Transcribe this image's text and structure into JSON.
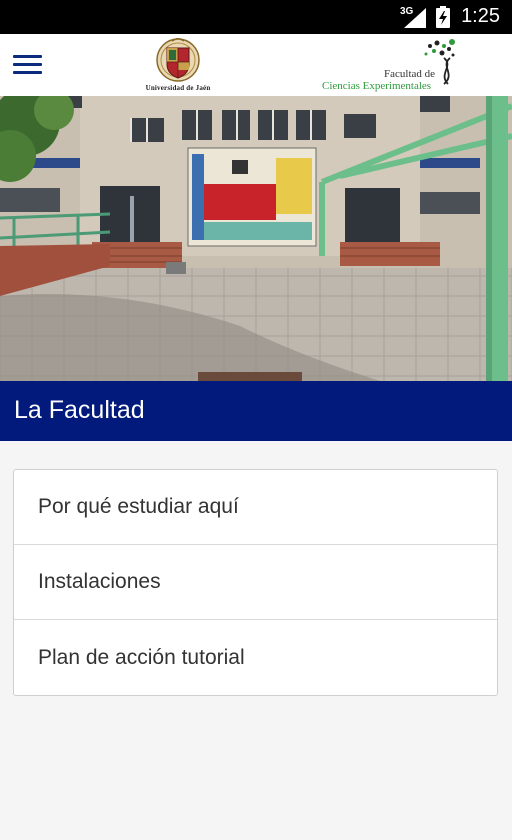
{
  "status_bar": {
    "network": "3G",
    "time": "1:25"
  },
  "header": {
    "university_name": "Universidad de Jaén",
    "faculty_line1": "Facultad de",
    "faculty_line2": "Ciencias Experimentales"
  },
  "hero": {
    "alt": "Edificio de la Facultad de Ciencias Experimentales"
  },
  "section": {
    "title": "La Facultad"
  },
  "menu": {
    "items": [
      {
        "label": "Por qué estudiar aquí"
      },
      {
        "label": "Instalaciones"
      },
      {
        "label": "Plan de acción tutorial"
      }
    ]
  },
  "colors": {
    "brand_blue": "#011a7b",
    "menu_icon": "#0b2a7e",
    "faculty_green": "#2e9a3c"
  }
}
